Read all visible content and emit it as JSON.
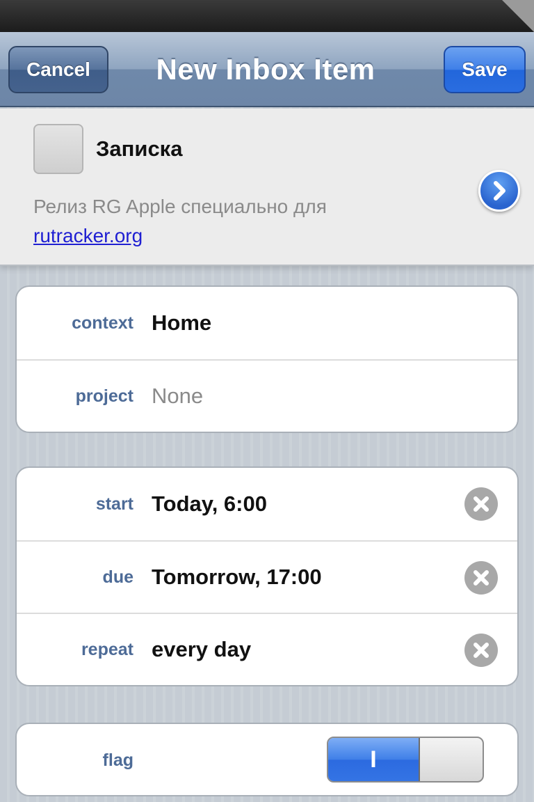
{
  "nav": {
    "cancel_label": "Cancel",
    "title": "New Inbox Item",
    "save_label": "Save"
  },
  "task": {
    "title": "Записка",
    "note": "Релиз RG Apple специально для",
    "link": "rutracker.org",
    "checked": false
  },
  "group1": [
    {
      "label": "context",
      "value": "Home"
    },
    {
      "label": "project",
      "value": "None"
    }
  ],
  "group2": [
    {
      "label": "start",
      "value": "Today, 6:00"
    },
    {
      "label": "due",
      "value": "Tomorrow, 17:00"
    },
    {
      "label": "repeat",
      "value": "every day"
    }
  ],
  "flag": {
    "label": "flag",
    "on_glyph": "I",
    "state": "on"
  },
  "icons": {
    "disclosure": "chevron-right-icon",
    "clear": "clear-x-icon"
  },
  "colors": {
    "label_blue": "#4d6b97",
    "save_blue": "#2a6de0",
    "link_blue": "#1f1fd2"
  }
}
